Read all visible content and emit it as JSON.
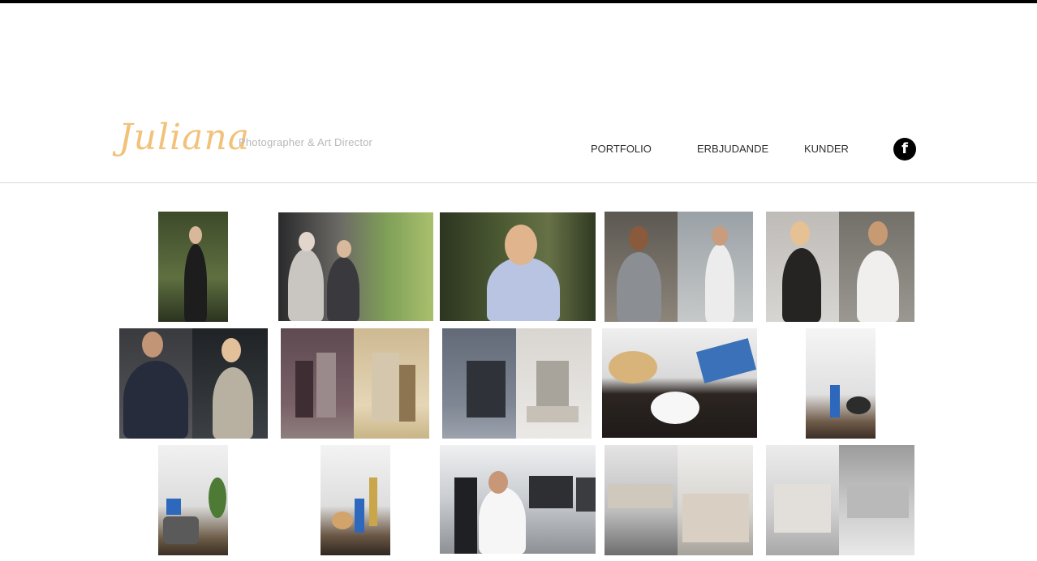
{
  "brand": {
    "logo": "Juliana",
    "tagline": "Photographer & Art Director"
  },
  "nav": {
    "portfolio": "PORTFOLIO",
    "erbjudande": "ERBJUDANDE",
    "kunder": "KUNDER",
    "facebook_glyph": "f"
  },
  "gallery": {
    "rows": 3,
    "photos": [
      {
        "subject": "woman-in-forest"
      },
      {
        "subject": "two-women-by-car"
      },
      {
        "subject": "smiling-woman-portrait"
      },
      {
        "subject": "chef-woman-and-man"
      },
      {
        "subject": "woman-and-chef-diptych"
      },
      {
        "subject": "chef-and-apron-woman"
      },
      {
        "subject": "interior-shelves-mauve"
      },
      {
        "subject": "interior-grey-furniture"
      },
      {
        "subject": "cookies-and-coffee"
      },
      {
        "subject": "kitchen-bottle"
      },
      {
        "subject": "cooking-pot"
      },
      {
        "subject": "bread-and-bottle"
      },
      {
        "subject": "office-man-phone"
      },
      {
        "subject": "dining-and-bedroom"
      },
      {
        "subject": "bedroom-cushions"
      }
    ]
  }
}
